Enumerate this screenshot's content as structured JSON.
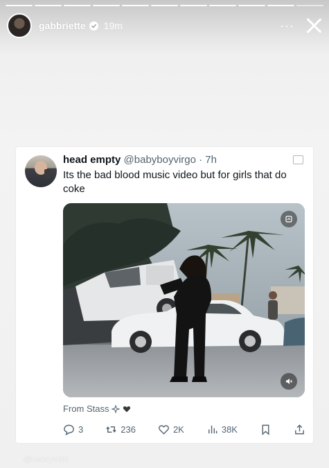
{
  "story": {
    "progress_segments": 11,
    "progress_viewed": 10,
    "username": "gabbriette",
    "time": "19m",
    "more_label": "···"
  },
  "tweet": {
    "display_name": "head empty",
    "meta": "@babyboyvirgo · 7h",
    "text": "Its the bad blood music video but for girls that do coke",
    "from_label": "From Stass",
    "counts": {
      "replies": "3",
      "reposts": "236",
      "likes": "2K",
      "views": "38K"
    }
  },
  "watermark": "@trendychild",
  "colors": {
    "text_primary": "#0f1419",
    "text_secondary": "#536471",
    "card_bg": "#ffffff",
    "story_bg": "#efefef"
  },
  "icons": {
    "verified": "verified-badge-icon",
    "close": "close-icon",
    "reply": "reply-icon",
    "repost": "repost-icon",
    "like": "heart-icon",
    "views": "views-icon",
    "bookmark": "bookmark-icon",
    "share": "share-icon",
    "mute": "mute-icon",
    "media_badge": "media-badge-icon"
  }
}
